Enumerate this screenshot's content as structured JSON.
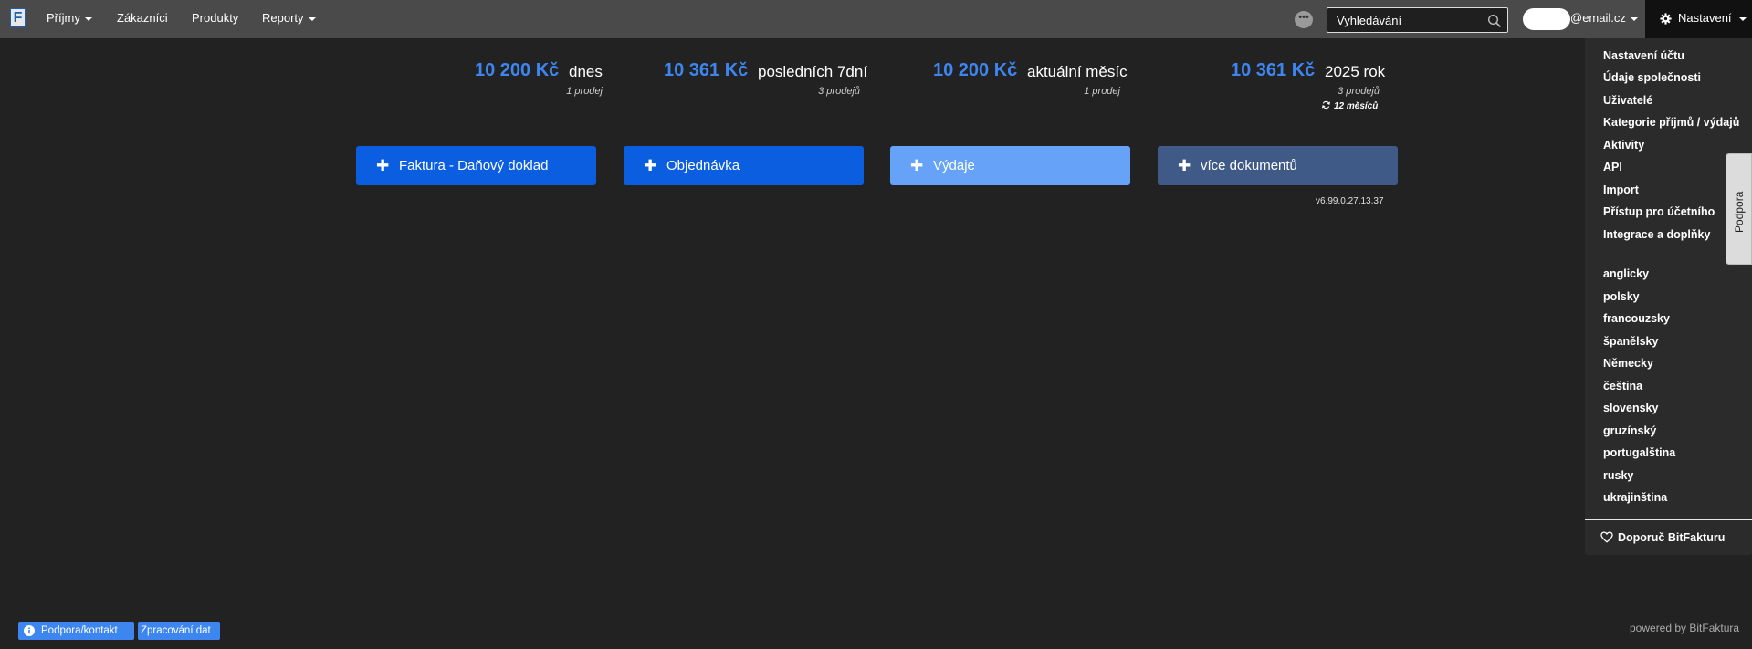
{
  "navbar": {
    "logo_letter": "F",
    "items": [
      {
        "label": "Příjmy",
        "has_caret": true
      },
      {
        "label": "Zákazníci",
        "has_caret": false
      },
      {
        "label": "Produkty",
        "has_caret": false
      },
      {
        "label": "Reporty",
        "has_caret": true
      }
    ],
    "more_label": "•••",
    "search_placeholder": "Vyhledávání",
    "user_email": "@email.cz",
    "settings_label": "Nastavení"
  },
  "stats": [
    {
      "amount": "10 200 Kč",
      "label": "dnes",
      "sub": "1 prodej"
    },
    {
      "amount": "10 361 Kč",
      "label": "posledních 7dní",
      "sub": "3 prodejů"
    },
    {
      "amount": "10 200 Kč",
      "label": "aktuální měsíc",
      "sub": "1 prodej"
    },
    {
      "amount": "10 361 Kč",
      "label": "2025 rok",
      "sub": "3 prodejů",
      "sub2": "12 měsíců"
    }
  ],
  "actions": [
    {
      "label": "Faktura - Daňový doklad",
      "color": "#0b5ee0"
    },
    {
      "label": "Objednávka",
      "color": "#0b5ee0"
    },
    {
      "label": "Výdaje",
      "color": "#66a2f7"
    },
    {
      "label": "více dokumentů",
      "color": "#3f5a87"
    }
  ],
  "version": "v6.99.0.27.13.37",
  "dropdown": {
    "settings_items": [
      "Nastavení účtu",
      "Údaje společnosti",
      "Uživatelé",
      "Kategorie příjmů / výdajů",
      "Aktivity",
      "API",
      "Import",
      "Přístup pro účetního",
      "Integrace a doplňky"
    ],
    "languages": [
      "anglicky",
      "polsky",
      "francouzsky",
      "španělsky",
      "Německy",
      "čeština",
      "slovensky",
      "gruzínský",
      "portugalština",
      "rusky",
      "ukrajinština"
    ],
    "recommend": "Doporuč BitFakturu"
  },
  "support_tab": "Podpora",
  "footer": {
    "support_contact": "Podpora/kontakt",
    "data_processing": "Zpracování dat",
    "powered_by": "powered by BitFaktura"
  },
  "colors": {
    "accent_blue": "#3d86f0",
    "primary_button": "#0b5ee0",
    "navbar_bg": "#4a4a4a",
    "page_bg": "#222222"
  }
}
